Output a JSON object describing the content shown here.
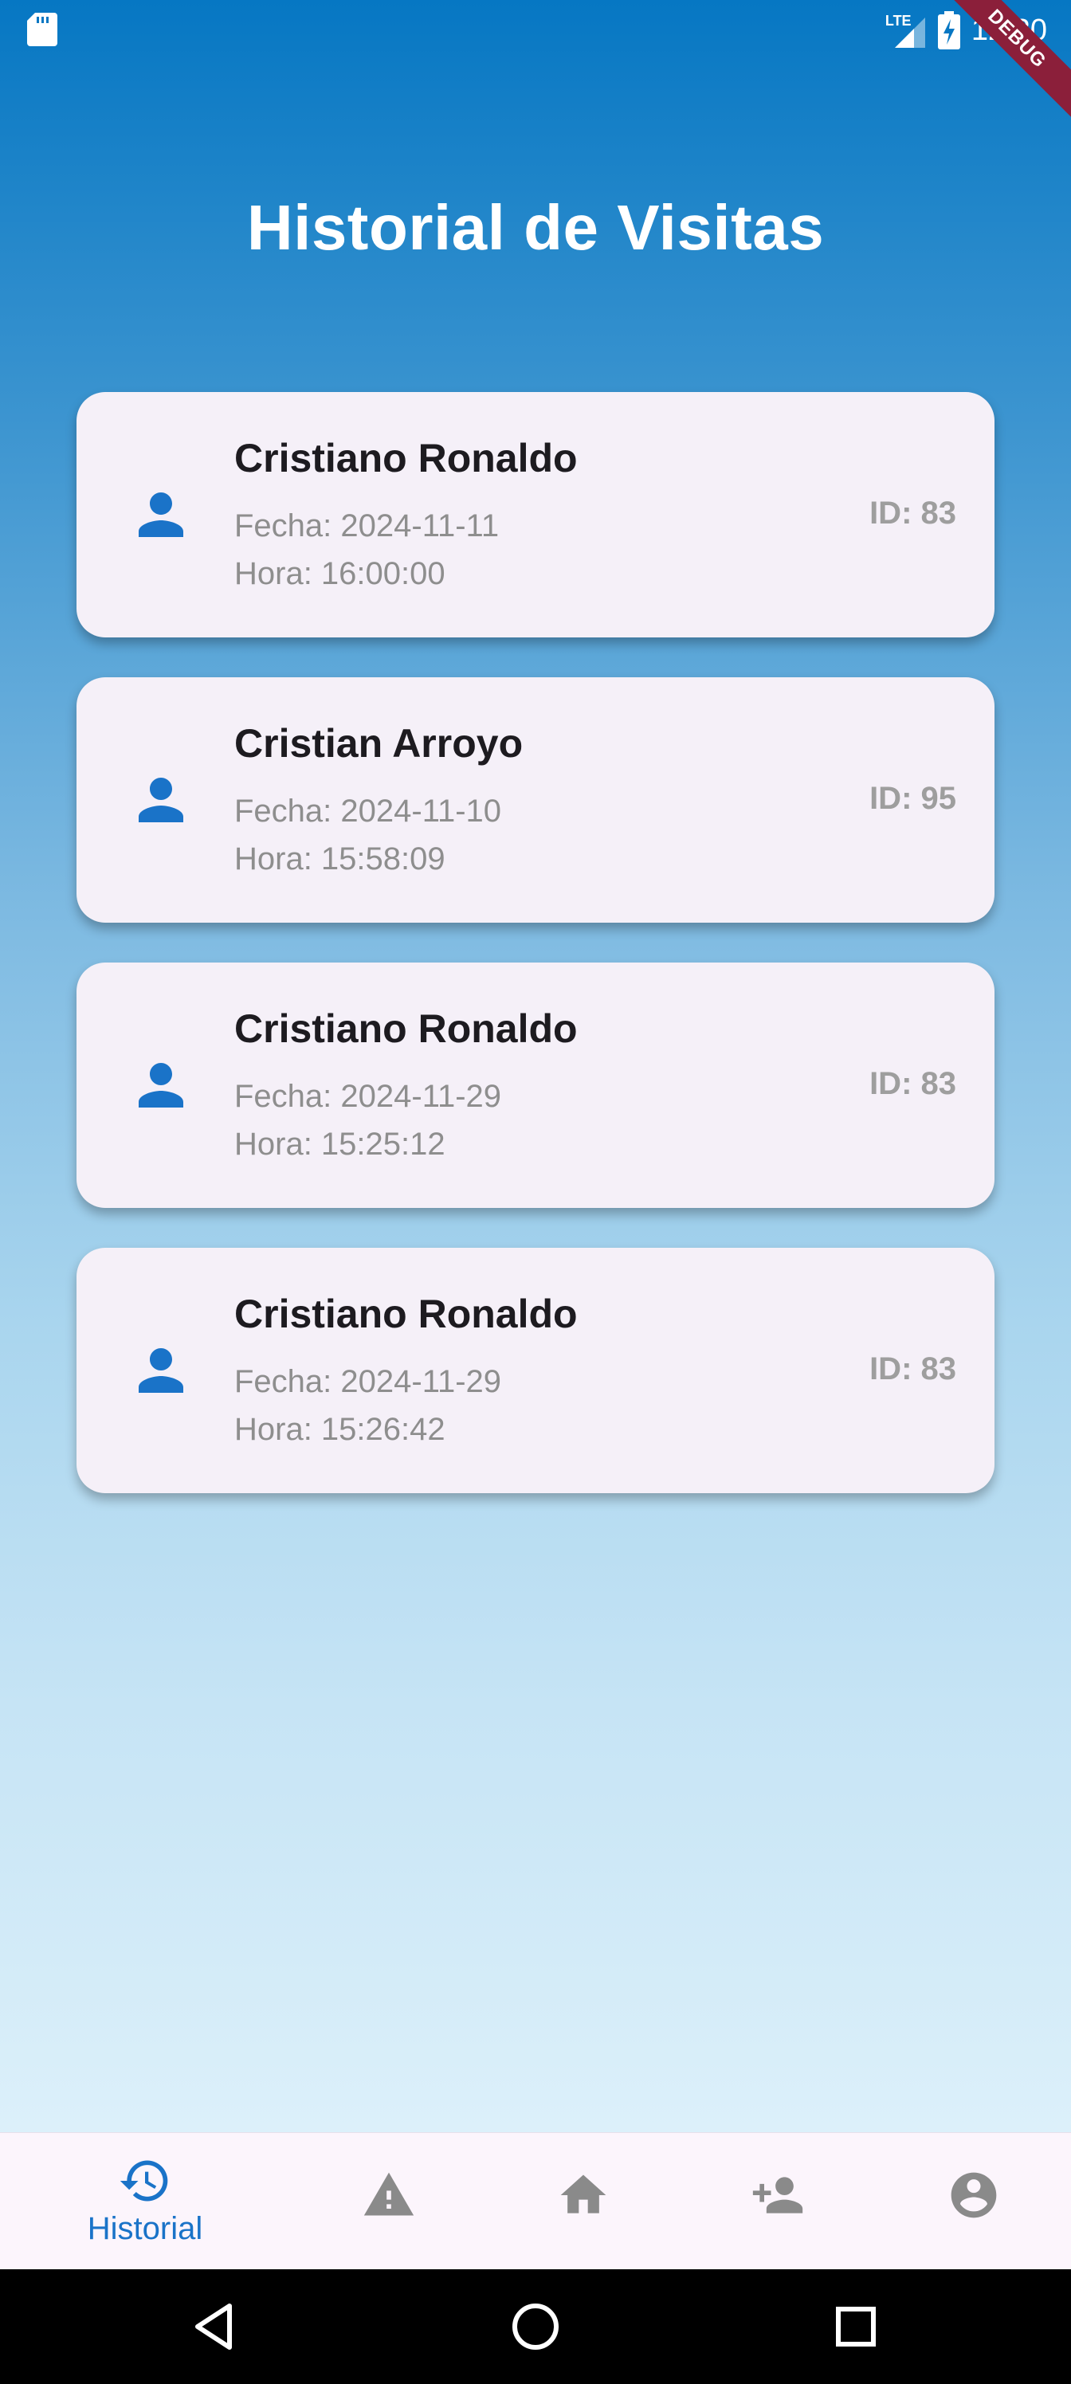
{
  "status_bar": {
    "time": "12:30",
    "network": "LTE",
    "debug_banner": "DEBUG",
    "icons": [
      "sd-card-icon",
      "signal-icon",
      "battery-charging-icon"
    ]
  },
  "page": {
    "title": "Historial de Visitas"
  },
  "visits": [
    {
      "name": "Cristiano Ronaldo",
      "date": "Fecha: 2024-11-11",
      "time": "Hora: 16:00:00",
      "id": "ID: 83"
    },
    {
      "name": "Cristian Arroyo",
      "date": "Fecha: 2024-11-10",
      "time": "Hora: 15:58:09",
      "id": "ID: 95"
    },
    {
      "name": "Cristiano Ronaldo",
      "date": "Fecha: 2024-11-29",
      "time": "Hora: 15:25:12",
      "id": "ID: 83"
    },
    {
      "name": "Cristiano Ronaldo",
      "date": "Fecha: 2024-11-29",
      "time": "Hora: 15:26:42",
      "id": "ID: 83"
    }
  ],
  "bottom_nav": {
    "selected": "historial",
    "items": [
      {
        "key": "historial",
        "label": "Historial",
        "icon": "history-icon"
      },
      {
        "key": "alerts",
        "label": "",
        "icon": "warning-icon"
      },
      {
        "key": "home",
        "label": "",
        "icon": "home-icon"
      },
      {
        "key": "add-person",
        "label": "",
        "icon": "person-add-icon"
      },
      {
        "key": "profile",
        "label": "",
        "icon": "account-circle-icon"
      }
    ]
  },
  "system_nav": {
    "icons": [
      "back-icon",
      "home-circle-icon",
      "recents-icon"
    ]
  },
  "colors": {
    "accent": "#1a73c8",
    "card_background": "#f5f0f8",
    "gradient_top": "#0677c3",
    "gradient_bottom": "#dcf0fa",
    "inactive_icon": "#8a8a8a",
    "debug_banner": "#8b1f3a"
  }
}
